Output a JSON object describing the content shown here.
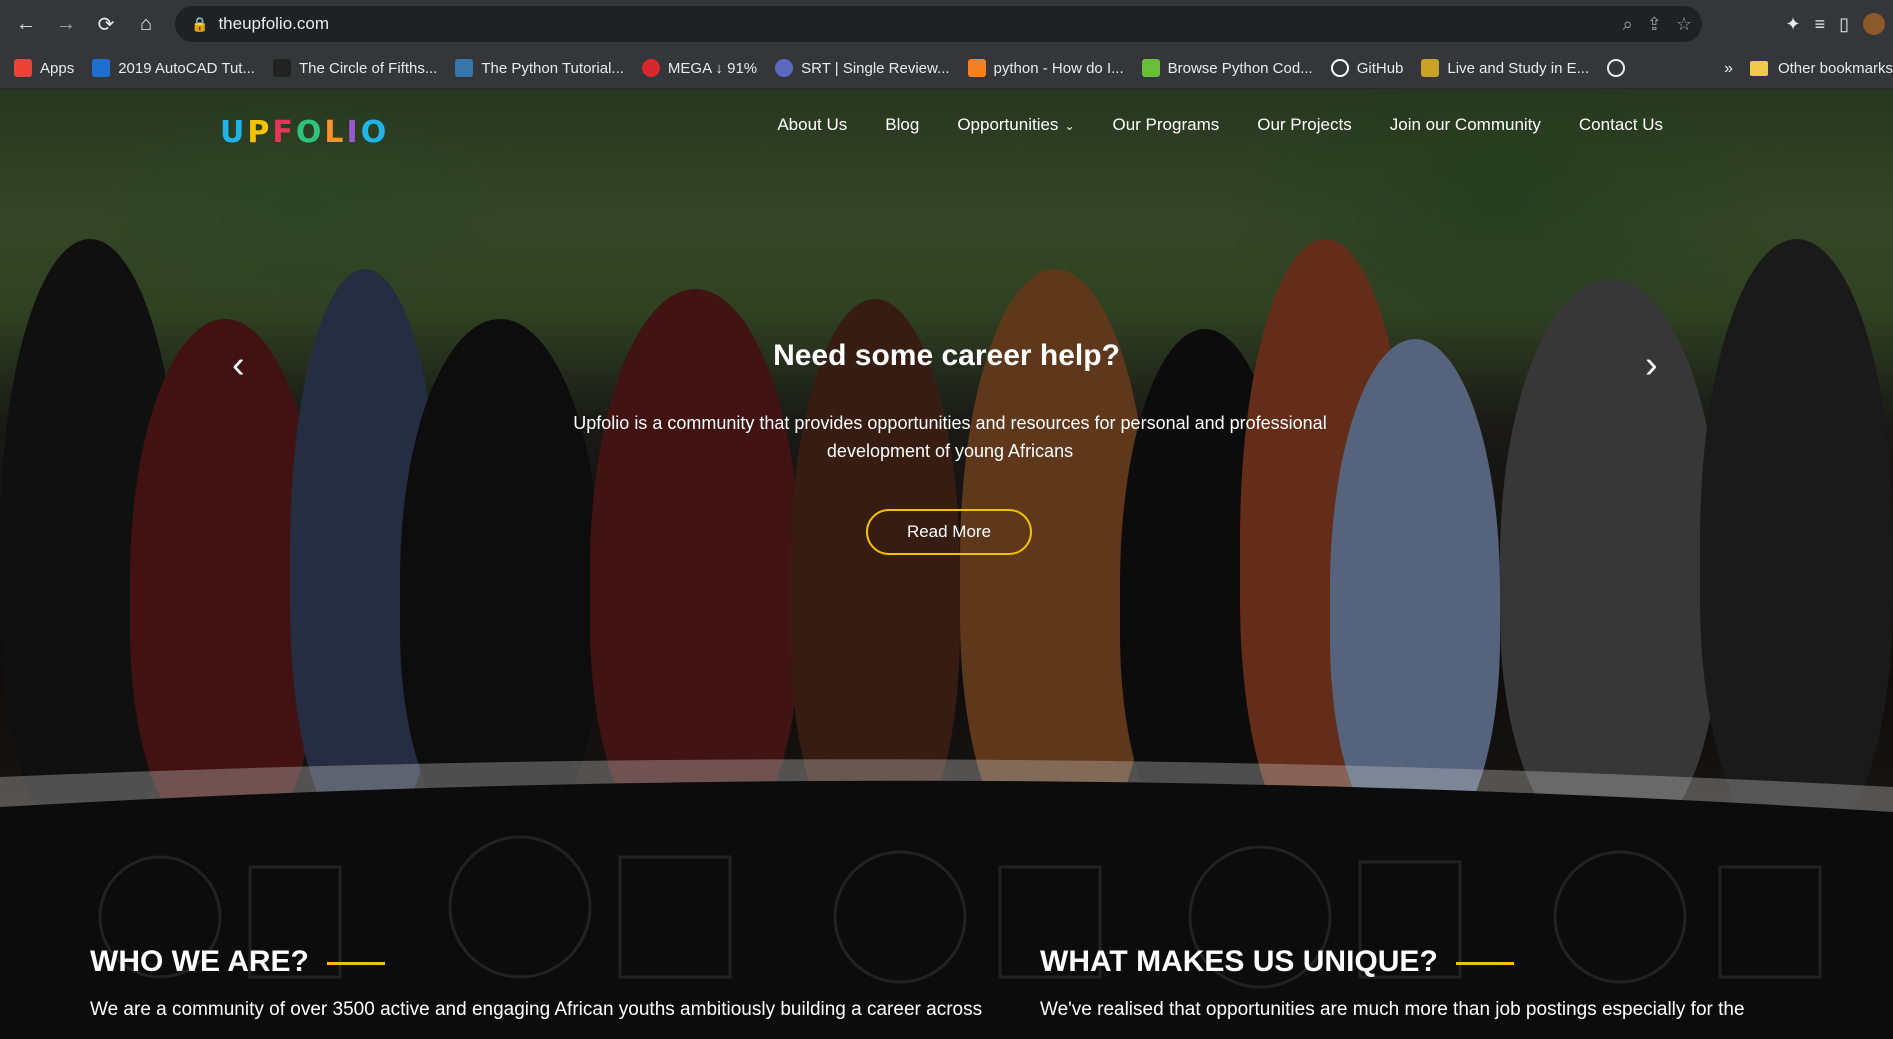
{
  "browser": {
    "url": "theupfolio.com",
    "nav_icons": [
      "back-icon",
      "forward-icon",
      "reload-icon",
      "home-icon"
    ],
    "bookmarks": [
      {
        "label": "Apps",
        "icon": "apps-grid-icon",
        "color": "#ea4335"
      },
      {
        "label": "2019 AutoCAD Tut...",
        "icon": "autocad-icon",
        "color": "#1f6fd1"
      },
      {
        "label": "The Circle of Fifths...",
        "icon": "sb-icon",
        "color": "#222222"
      },
      {
        "label": "The Python Tutorial...",
        "icon": "python-icon",
        "color": "#3776ab"
      },
      {
        "label": "MEGA ↓ 91%",
        "icon": "mega-icon",
        "color": "#d9272e"
      },
      {
        "label": "SRT | Single Review...",
        "icon": "srt-icon",
        "color": "#5c6bc0"
      },
      {
        "label": "python - How do I...",
        "icon": "stackoverflow-icon",
        "color": "#f48024"
      },
      {
        "label": "Browse Python Cod...",
        "icon": "code-icon",
        "color": "#6abf3a"
      },
      {
        "label": "GitHub",
        "icon": "github-icon",
        "color": "#ffffff"
      },
      {
        "label": "Live and Study in E...",
        "icon": "study-icon",
        "color": "#c9a227"
      },
      {
        "label": "",
        "icon": "globe-icon",
        "color": "#e8eaed"
      }
    ],
    "more_label": "»",
    "other_bookmarks": "Other bookmarks"
  },
  "site": {
    "logo": [
      "U",
      "P",
      "F",
      "O",
      "L",
      "I",
      "O"
    ],
    "logo_colors": [
      "#1fb5e8",
      "#f7c200",
      "#e8345a",
      "#2ec27e",
      "#f7932f",
      "#9b59d0",
      "#1fb5e8"
    ],
    "menu": [
      "About Us",
      "Blog",
      "Opportunities",
      "Our Programs",
      "Our Projects",
      "Join our Community",
      "Contact Us"
    ],
    "hero": {
      "title": "Need some career help?",
      "description": "Upfolio is a community that provides opportunities and resources for personal and professional development of young Africans",
      "button": "Read More",
      "accent": "#f2c200"
    },
    "sections": [
      {
        "title": "WHO WE ARE?",
        "text": "We are a community of over 3500 active and engaging African youths ambitiously building a career across"
      },
      {
        "title": "WHAT MAKES US UNIQUE?",
        "text": "We've realised that opportunities are much more than job postings especially for the"
      }
    ]
  }
}
